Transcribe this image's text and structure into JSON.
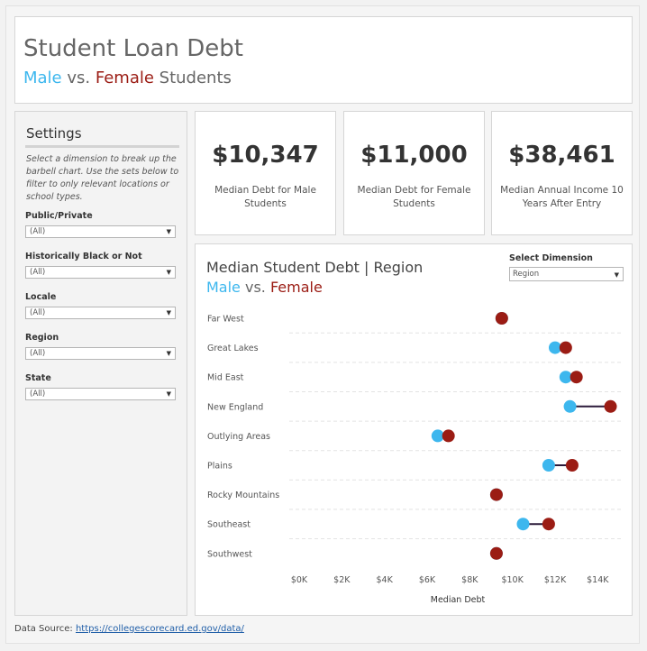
{
  "header": {
    "title": "Student Loan Debt",
    "subtitle_male": "Male",
    "subtitle_vs": " vs. ",
    "subtitle_female": "Female",
    "subtitle_rest": " Students"
  },
  "settings": {
    "title": "Settings",
    "description": "Select a dimension to break up the barbell chart. Use the sets below to filter to only relevant locations or school types.",
    "filters": [
      {
        "label": "Public/Private",
        "value": "(All)"
      },
      {
        "label": "Historically Black or Not",
        "value": "(All)"
      },
      {
        "label": "Locale",
        "value": "(All)"
      },
      {
        "label": "Region",
        "value": "(All)"
      },
      {
        "label": "State",
        "value": "(All)"
      }
    ]
  },
  "kpis": {
    "male": {
      "value": "$10,347",
      "label": "Median Debt for Male Students"
    },
    "female": {
      "value": "$11,000",
      "label": "Median Debt for Female Students"
    },
    "income": {
      "value": "$38,461",
      "label": "Median Annual Income 10 Years After Entry"
    }
  },
  "chart_panel": {
    "title": "Median Student Debt | Region",
    "subtitle_male": "Male",
    "subtitle_vs": " vs. ",
    "subtitle_female": "Female",
    "dimension_label": "Select Dimension",
    "dimension_value": "Region"
  },
  "colors": {
    "male": "#3db7ee",
    "female": "#9b1c14",
    "connector": "#2b1a3a"
  },
  "chart_data": {
    "type": "scatter",
    "subtype": "barbell",
    "title": "Median Student Debt | Region",
    "xlabel": "Median Debt",
    "ylabel": "",
    "xlim": [
      0,
      15000
    ],
    "x_ticks": [
      0,
      2000,
      4000,
      6000,
      8000,
      10000,
      12000,
      14000
    ],
    "x_tick_labels": [
      "$0K",
      "$2K",
      "$4K",
      "$6K",
      "$8K",
      "$10K",
      "$12K",
      "$14K"
    ],
    "grid": "horizontal dashed",
    "categories": [
      "Far West",
      "Great Lakes",
      "Mid East",
      "New England",
      "Outlying Areas",
      "Plains",
      "Rocky Mountains",
      "Southeast",
      "Southwest"
    ],
    "series": [
      {
        "name": "Male",
        "values": [
          9500,
          12000,
          12500,
          12700,
          6500,
          11700,
          9250,
          10500,
          9250
        ]
      },
      {
        "name": "Female",
        "values": [
          9500,
          12500,
          13000,
          14600,
          7000,
          12800,
          9250,
          11700,
          9250
        ]
      }
    ]
  },
  "footer": {
    "prefix": "Data Source: ",
    "link_text": "https://collegescorecard.ed.gov/data/"
  }
}
